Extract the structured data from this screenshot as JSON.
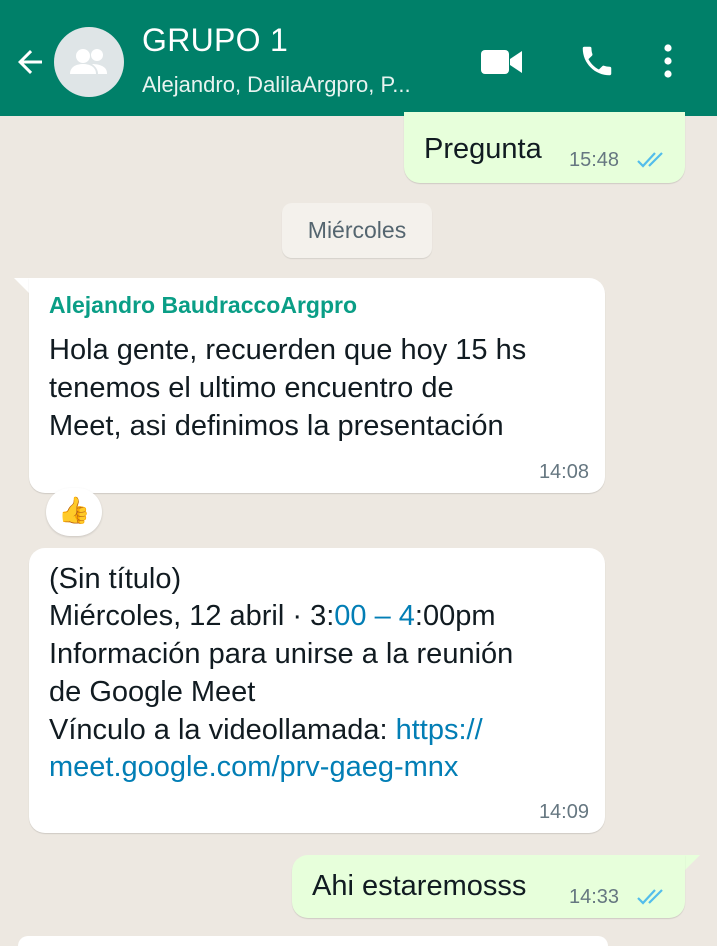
{
  "header": {
    "title": "GRUPO 1",
    "subtitle": "Alejandro, DalilaArgpro, P...",
    "icons": [
      "back-arrow-icon",
      "group-avatar-icon",
      "video-call-icon",
      "phone-call-icon",
      "more-options-icon"
    ]
  },
  "colors": {
    "header": "#008069",
    "outgoing_bubble": "#e7ffdb",
    "incoming_bubble": "#ffffff",
    "chat_background": "#ede8e1",
    "read_ticks": "#53bdeb",
    "sender_name": "#0a9e86",
    "link": "#027eb5"
  },
  "chat": {
    "day_chip": "Miércoles",
    "messages": [
      {
        "direction": "out",
        "text": "Pregunta",
        "time": "15:48",
        "status": "read"
      },
      {
        "direction": "in",
        "sender": "Alejandro BaudraccoArgpro",
        "lines": [
          "Hola gente, recuerden que hoy 15 hs",
          "tenemos el ultimo encuentro de",
          "Meet, asi definimos la presentación"
        ],
        "time": "14:08",
        "reaction": "👍"
      },
      {
        "direction": "in",
        "event_title": "(Sin título)",
        "date_prefix": "Miércoles, 12 abril · 3:",
        "date_link": "00 – 4",
        "date_suffix": ":00pm",
        "info_line1": "Información para unirse a la reunión",
        "info_line2": "de Google Meet",
        "link_label": "Vínculo a la videollamada: ",
        "link_part1": "https://",
        "link_part2": "meet.google.com/prv-gaeg-mnx",
        "time": "14:09"
      },
      {
        "direction": "out",
        "text": "Ahi estaremosss",
        "time": "14:33",
        "status": "read"
      }
    ]
  }
}
